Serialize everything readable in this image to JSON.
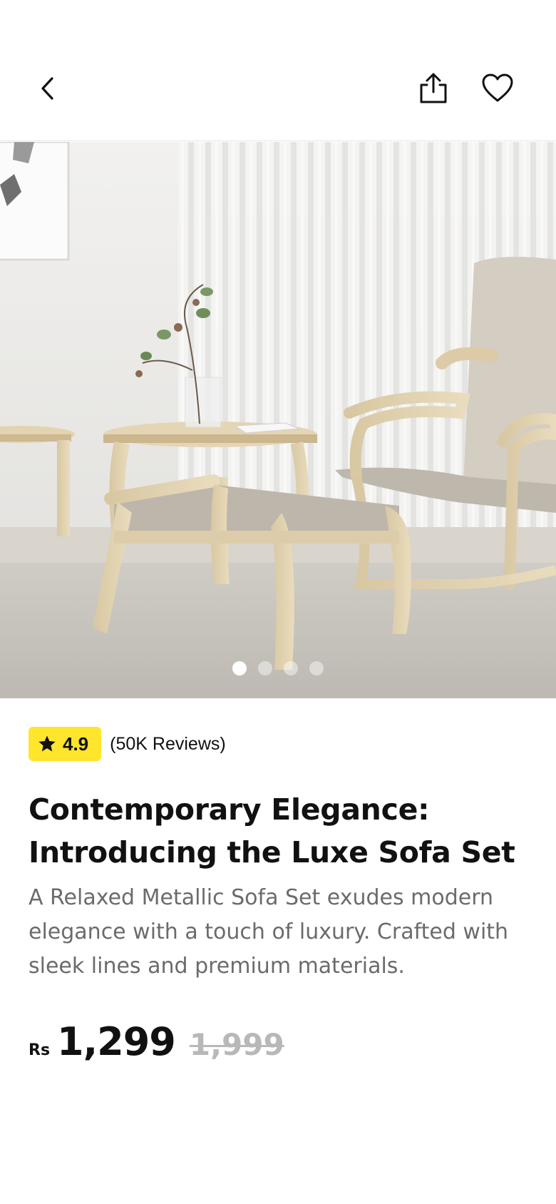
{
  "header": {
    "back_icon": "chevron-left-icon",
    "share_icon": "share-icon",
    "favorite_icon": "heart-icon"
  },
  "gallery": {
    "image": "product-photo-armchair-footstool",
    "page_count": 4,
    "active_page": 1
  },
  "product": {
    "rating": "4.9",
    "rating_icon": "star-icon",
    "reviews": "(50K Reviews)",
    "title": "Contemporary Elegance: Introducing the Luxe Sofa Set",
    "description": "A Relaxed Metallic Sofa Set exudes modern elegance with a touch of luxury. Crafted with sleek lines and premium materials.",
    "currency": "Rs",
    "price": "1,299",
    "old_price": "1,999"
  },
  "colors": {
    "rating_badge": "#ffe52c",
    "text": "#111111",
    "muted_text": "#6b6b6b",
    "old_price": "#b8b8b8"
  }
}
